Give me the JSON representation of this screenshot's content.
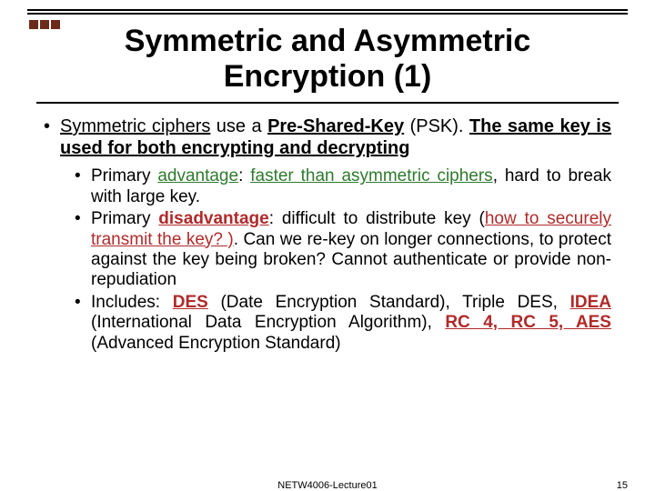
{
  "title_line1": "Symmetric and Asymmetric",
  "title_line2": "Encryption (1)",
  "main_bullet": {
    "prefix": "Symmetric ciphers",
    "mid": " use a ",
    "key_term": "Pre-Shared-Key",
    "suffix": " (PSK). ",
    "statement": "The same key is used for both encrypting and decrypting"
  },
  "sub": {
    "adv": {
      "lead": "Primary ",
      "word": "advantage",
      "colon": ": ",
      "phrase": "faster than asymmetric ciphers",
      "tail": ", hard to break with large key."
    },
    "dis": {
      "lead": "Primary ",
      "word": "disadvantage",
      "colon": ": difficult to distribute key (",
      "phrase": "how to securely transmit the key? )",
      "tail": ". Can we re-key on longer connections, to protect against the key being broken? Cannot authenticate or provide non-repudiation"
    },
    "inc": {
      "lead": "Includes: ",
      "des": "DES",
      "des_tail": " (Date Encryption Standard), Triple DES, ",
      "idea": "IDEA",
      "idea_tail": " (International Data Encryption Algorithm), ",
      "rc": "RC 4, RC 5, AES",
      "rc_tail": " (Advanced Encryption Standard)"
    }
  },
  "footer_center": "NETW4006-Lecture01",
  "footer_page": "15"
}
